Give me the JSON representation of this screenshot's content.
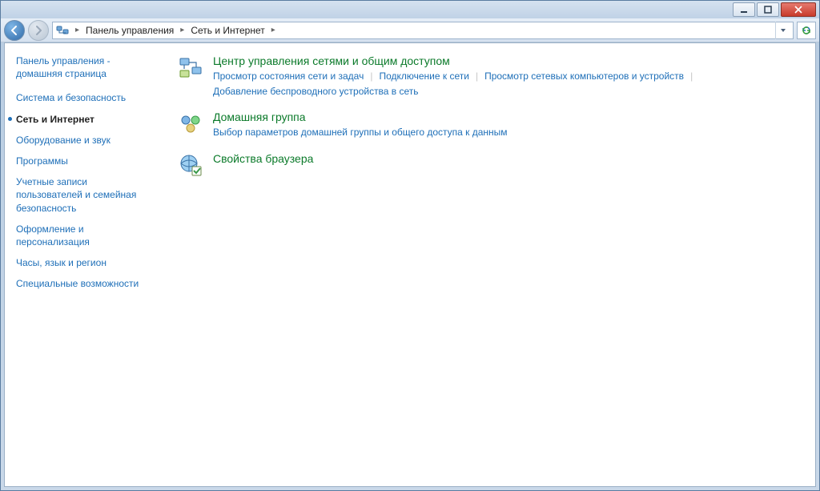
{
  "breadcrumb": {
    "root": "Панель управления",
    "current": "Сеть и Интернет"
  },
  "sidebar": {
    "home": "Панель управления - домашняя страница",
    "items": [
      {
        "label": "Система и безопасность",
        "active": false
      },
      {
        "label": "Сеть и Интернет",
        "active": true
      },
      {
        "label": "Оборудование и звук",
        "active": false
      },
      {
        "label": "Программы",
        "active": false
      },
      {
        "label": "Учетные записи пользователей и семейная безопасность",
        "active": false
      },
      {
        "label": "Оформление и персонализация",
        "active": false
      },
      {
        "label": "Часы, язык и регион",
        "active": false
      },
      {
        "label": "Специальные возможности",
        "active": false
      }
    ]
  },
  "categories": [
    {
      "title": "Центр управления сетями и общим доступом",
      "links": [
        "Просмотр состояния сети и задач",
        "Подключение к сети",
        "Просмотр сетевых компьютеров и устройств",
        "Добавление беспроводного устройства в сеть"
      ]
    },
    {
      "title": "Домашняя группа",
      "links": [
        "Выбор параметров домашней группы и общего доступа к данным"
      ]
    },
    {
      "title": "Свойства браузера",
      "links": []
    }
  ]
}
